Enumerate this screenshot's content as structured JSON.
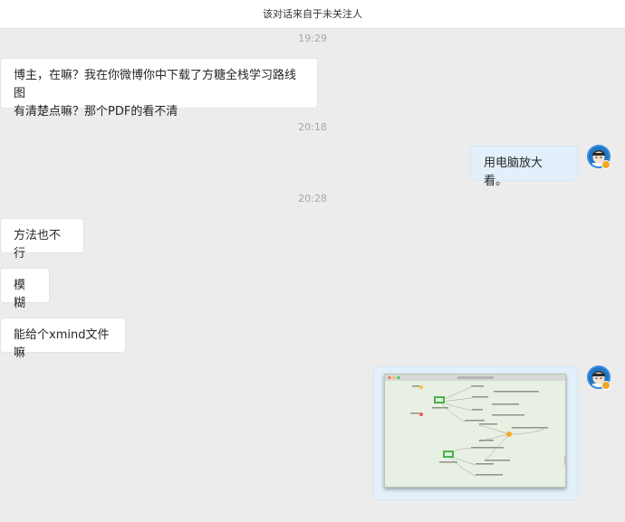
{
  "header": {
    "title": "该对话来自于未关注人"
  },
  "timestamps": [
    "19:29",
    "20:18",
    "20:28"
  ],
  "messages": [
    {
      "direction": "in",
      "text_line1": "博主，在嘛？我在你微博你中下载了方糖全栈学习路线图",
      "text_line2": "有清楚点嘛？那个PDF的看不清"
    },
    {
      "direction": "out",
      "text": "用电脑放大看。"
    },
    {
      "direction": "in",
      "text": "方法也不行"
    },
    {
      "direction": "in",
      "text": "模糊"
    },
    {
      "direction": "in",
      "text": "能给个xmind文件嘛"
    },
    {
      "direction": "out",
      "type": "image",
      "icon": "mindmap-thumbnail"
    }
  ],
  "colors": {
    "incoming_bubble": "#ffffff",
    "outgoing_bubble": "#e3f0fb",
    "background": "#ececec",
    "timestamp": "#a6a6a6",
    "avatar_ring": "#3b8ee0",
    "badge": "#f5a623"
  }
}
